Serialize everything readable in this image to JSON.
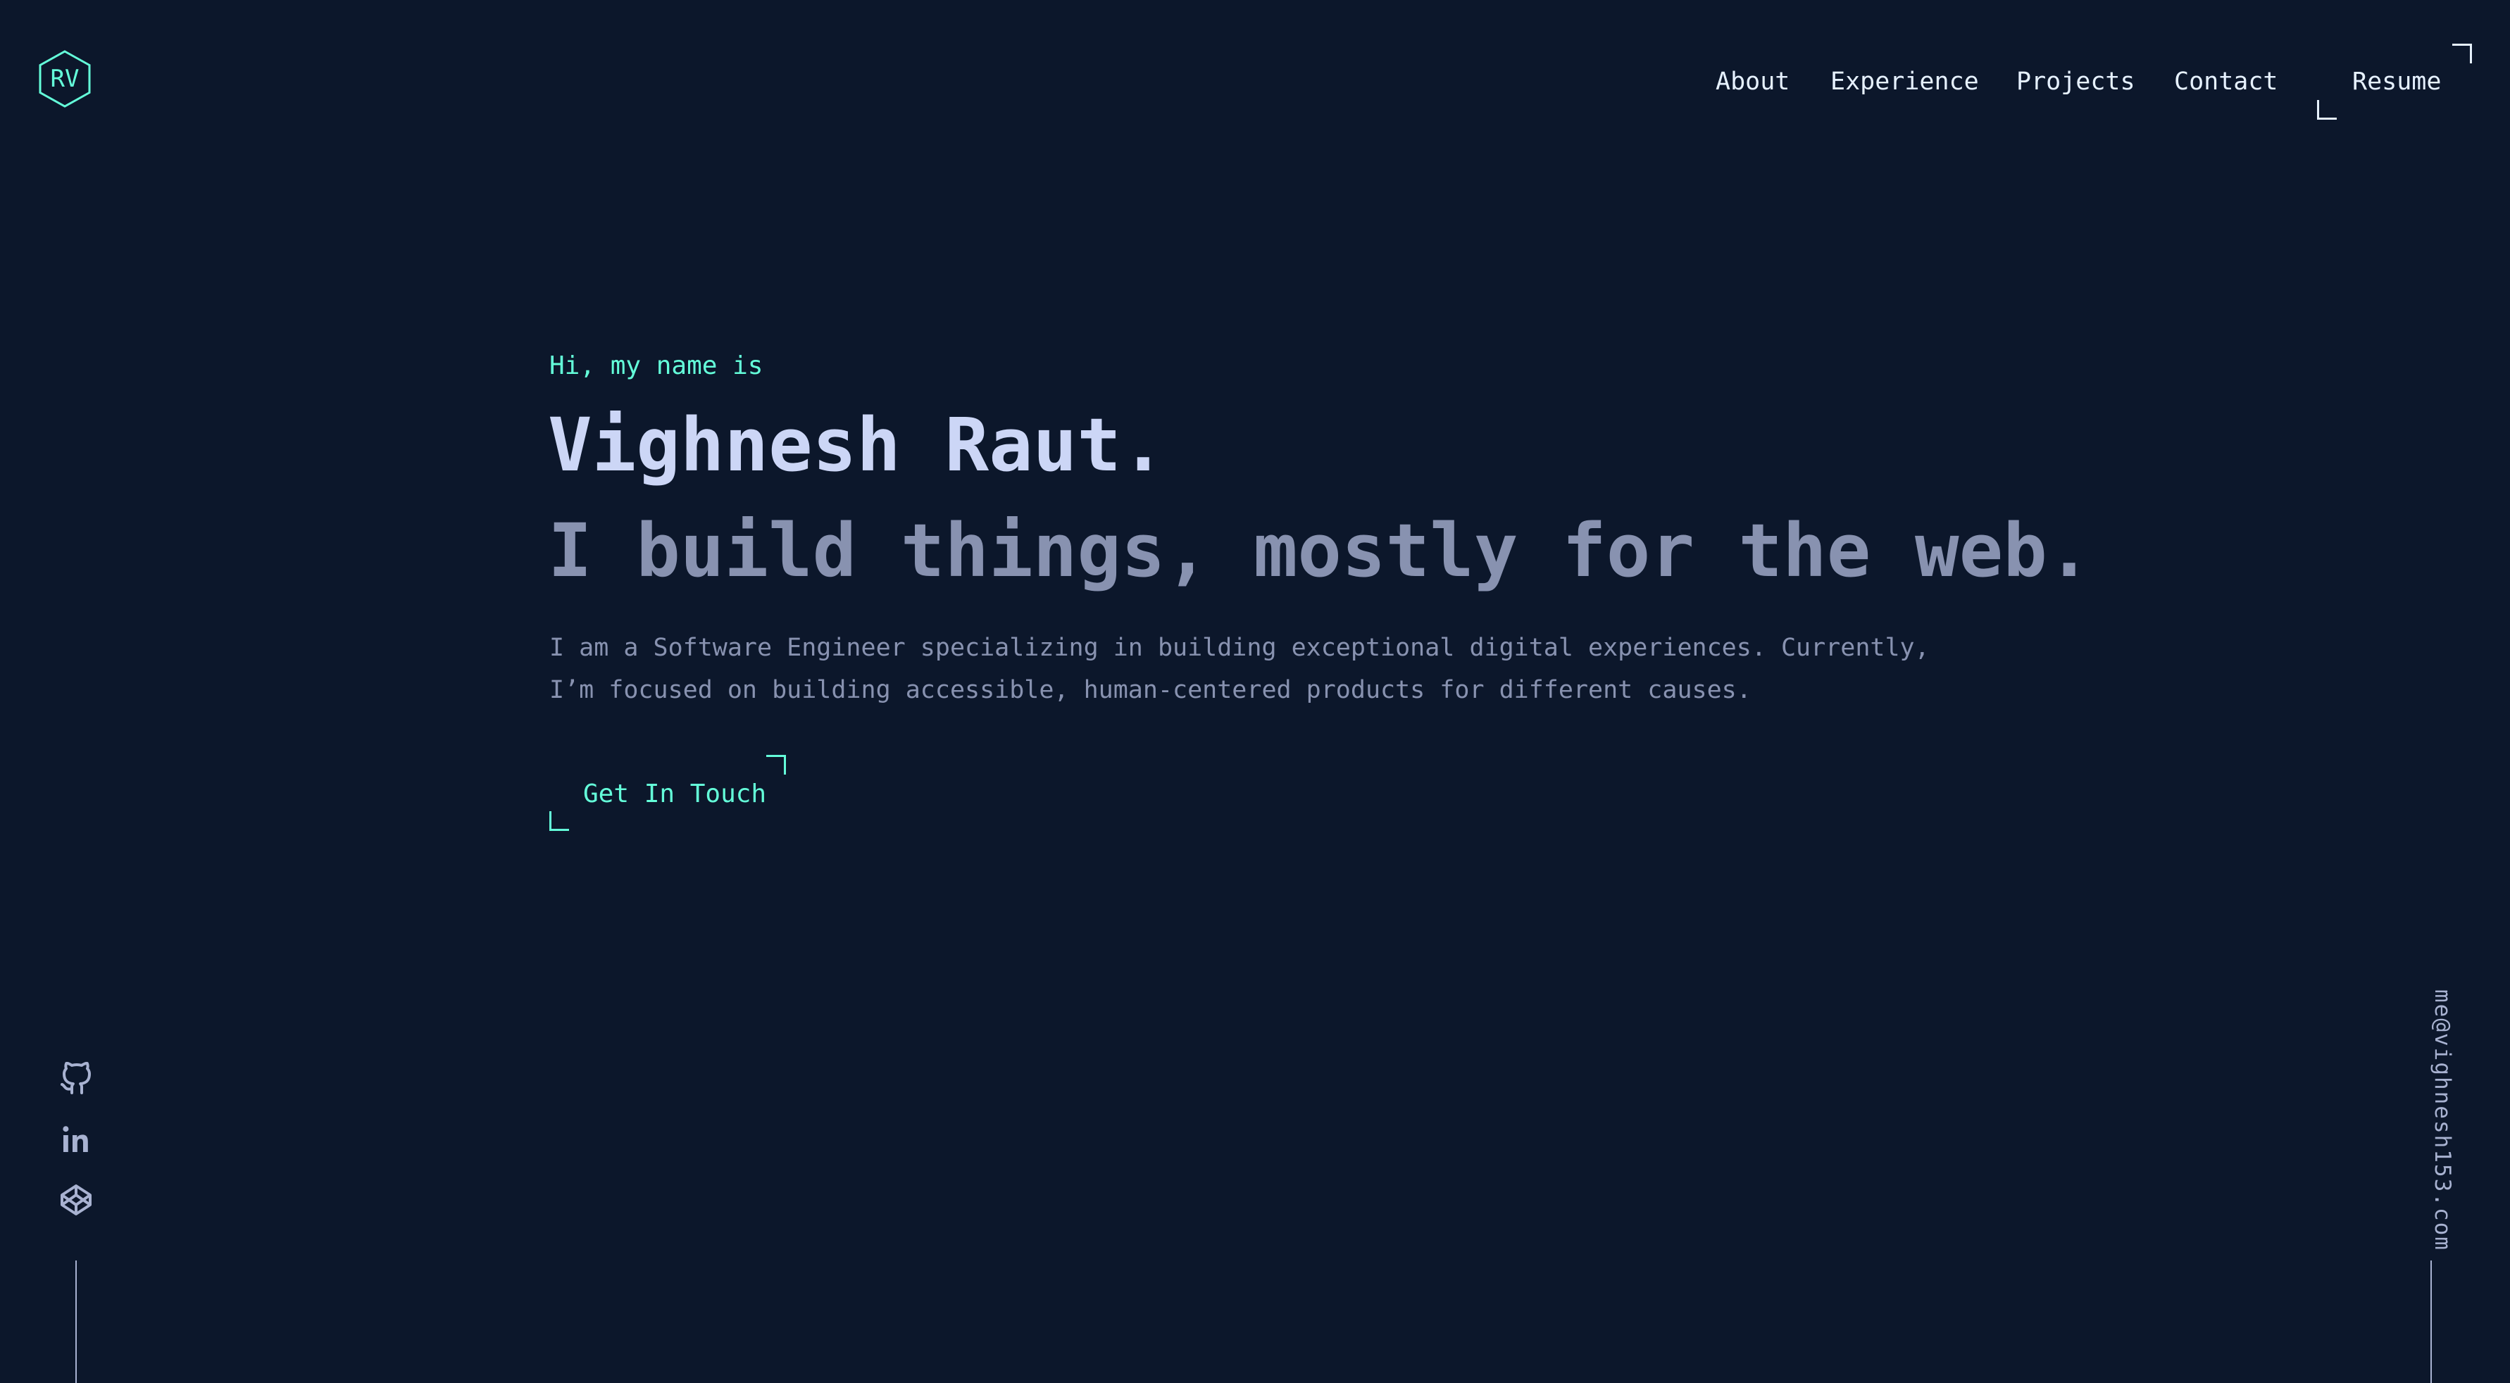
{
  "header": {
    "logo_text": "RV",
    "nav": {
      "about": "About",
      "experience": "Experience",
      "projects": "Projects",
      "contact": "Contact"
    },
    "resume_label": "Resume"
  },
  "hero": {
    "greeting": "Hi, my name is",
    "name": "Vighnesh Raut.",
    "tagline": "I build things, mostly for the web.",
    "description": "I am a Software Engineer specializing in building exceptional digital experiences. Currently, I’m focused on building accessible, human-centered products for different causes.",
    "cta_label": "Get In Touch"
  },
  "sidebar": {
    "social_icons": [
      "github-icon",
      "linkedin-icon",
      "codepen-icon"
    ],
    "email": "me@vighnesh153.com"
  },
  "colors": {
    "background": "#0c172b",
    "accent": "#64ffda",
    "heading": "#ccd6f6",
    "muted": "#8892b0",
    "nav_text": "#e6f1ff"
  }
}
